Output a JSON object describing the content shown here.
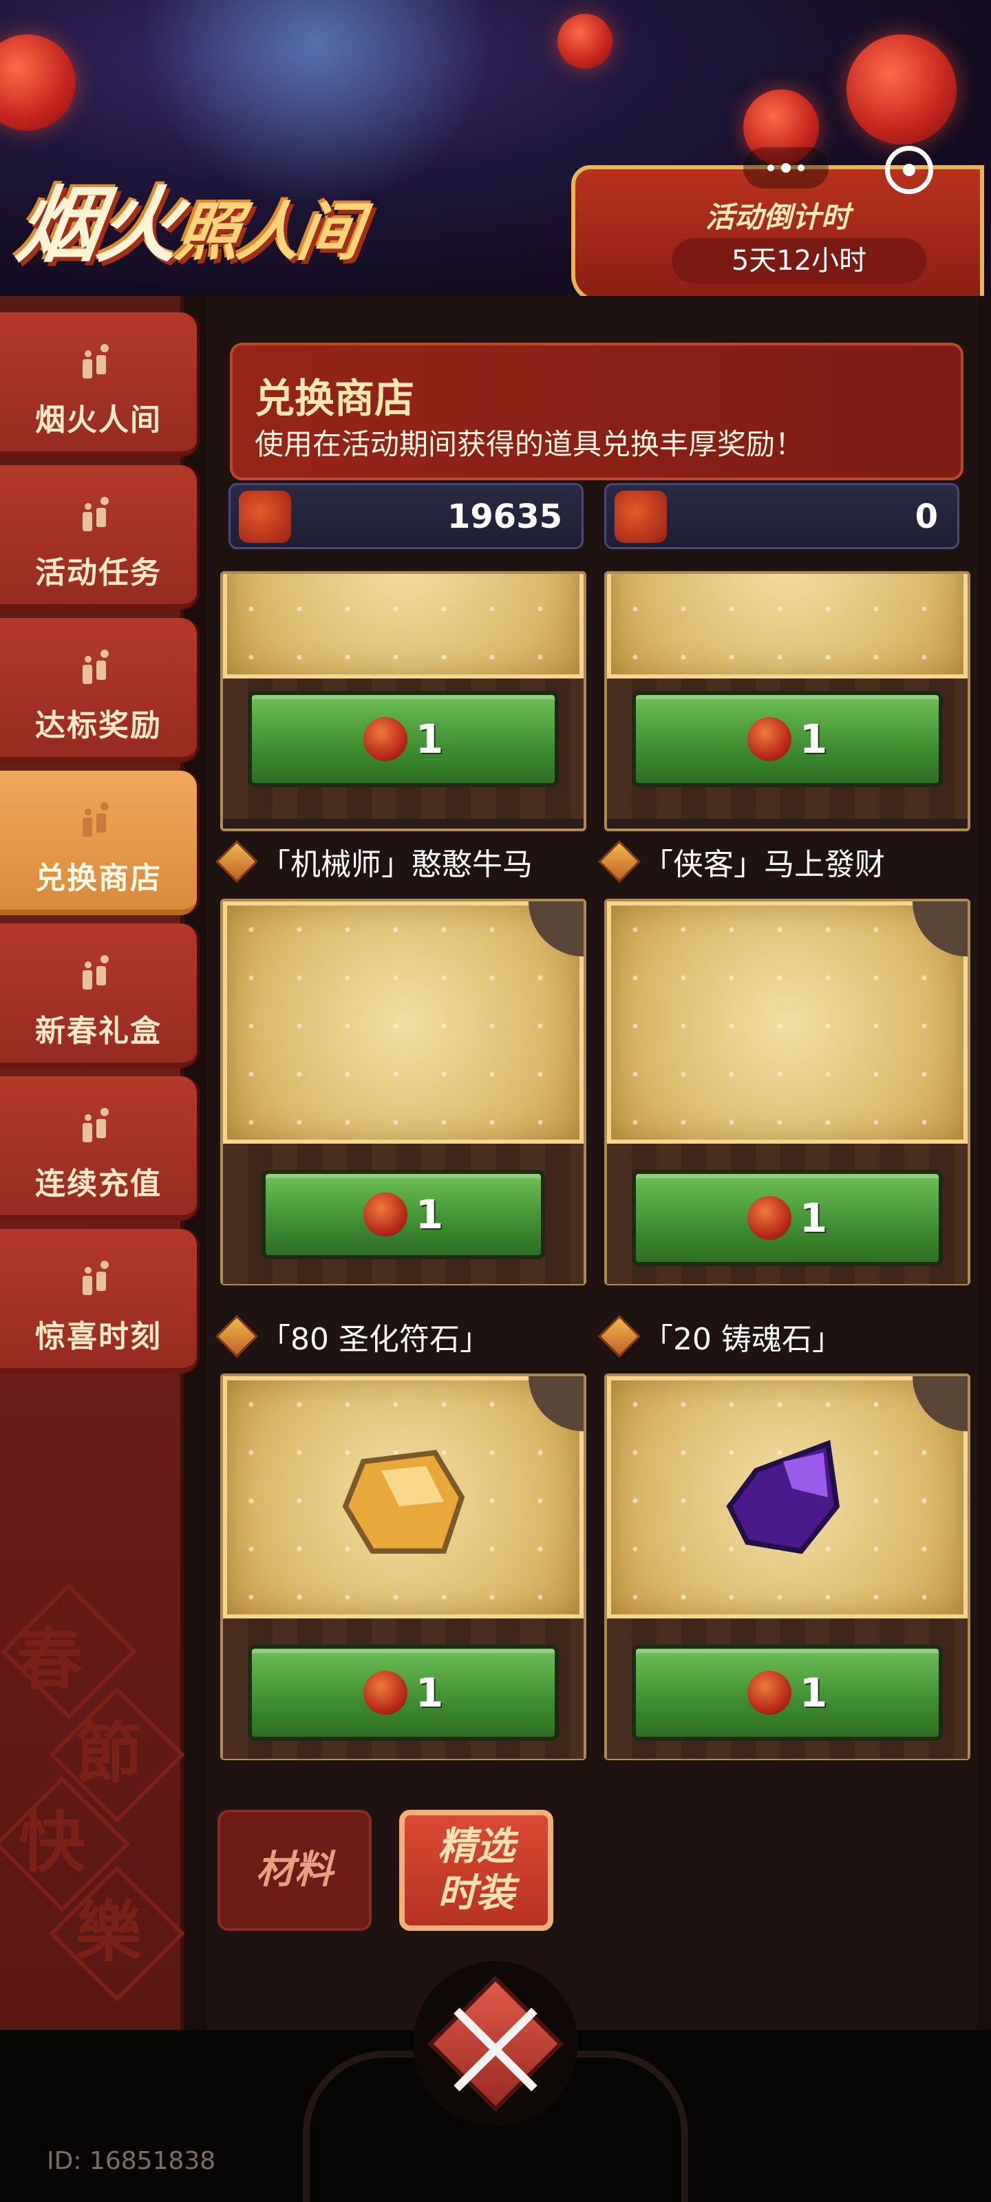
{
  "header": {
    "event_title_part1": "烟火",
    "event_title_part2": "照人间",
    "countdown_title": "活动倒计时",
    "countdown_value": "5天12小时"
  },
  "sidebar": {
    "items": [
      {
        "label": "烟火人间"
      },
      {
        "label": "活动任务"
      },
      {
        "label": "达标奖励"
      },
      {
        "label": "兑换商店",
        "active": true
      },
      {
        "label": "新春礼盒"
      },
      {
        "label": "连续充值"
      },
      {
        "label": "惊喜时刻"
      }
    ],
    "decor_chars": [
      "春",
      "節",
      "快",
      "樂"
    ]
  },
  "shop": {
    "title": "兑换商店",
    "description": "使用在活动期间获得的道具兑换丰厚奖励！",
    "currencies": [
      {
        "icon": "firecracker-token-icon",
        "value": "19635"
      },
      {
        "icon": "lucky-bag-icon",
        "value": "0"
      }
    ]
  },
  "items": [
    {
      "name": "",
      "cost": "1",
      "cost_icon": "lucky-bag-icon"
    },
    {
      "name": "",
      "cost": "1",
      "cost_icon": "lucky-bag-icon"
    },
    {
      "name": "「机械师」憨憨牛马",
      "cost": "1",
      "cost_icon": "lucky-bag-icon"
    },
    {
      "name": "「侠客」马上發财",
      "cost": "1",
      "cost_icon": "lucky-bag-icon"
    },
    {
      "name": "「80 圣化符石」",
      "cost": "1",
      "cost_icon": "lucky-bag-icon"
    },
    {
      "name": "「20 铸魂石」",
      "cost": "1",
      "cost_icon": "lucky-bag-icon"
    }
  ],
  "tabs": [
    {
      "label": "材料",
      "active": false
    },
    {
      "label": "精选时装",
      "active": true
    }
  ],
  "footer": {
    "id_text": "ID: 16851838"
  }
}
